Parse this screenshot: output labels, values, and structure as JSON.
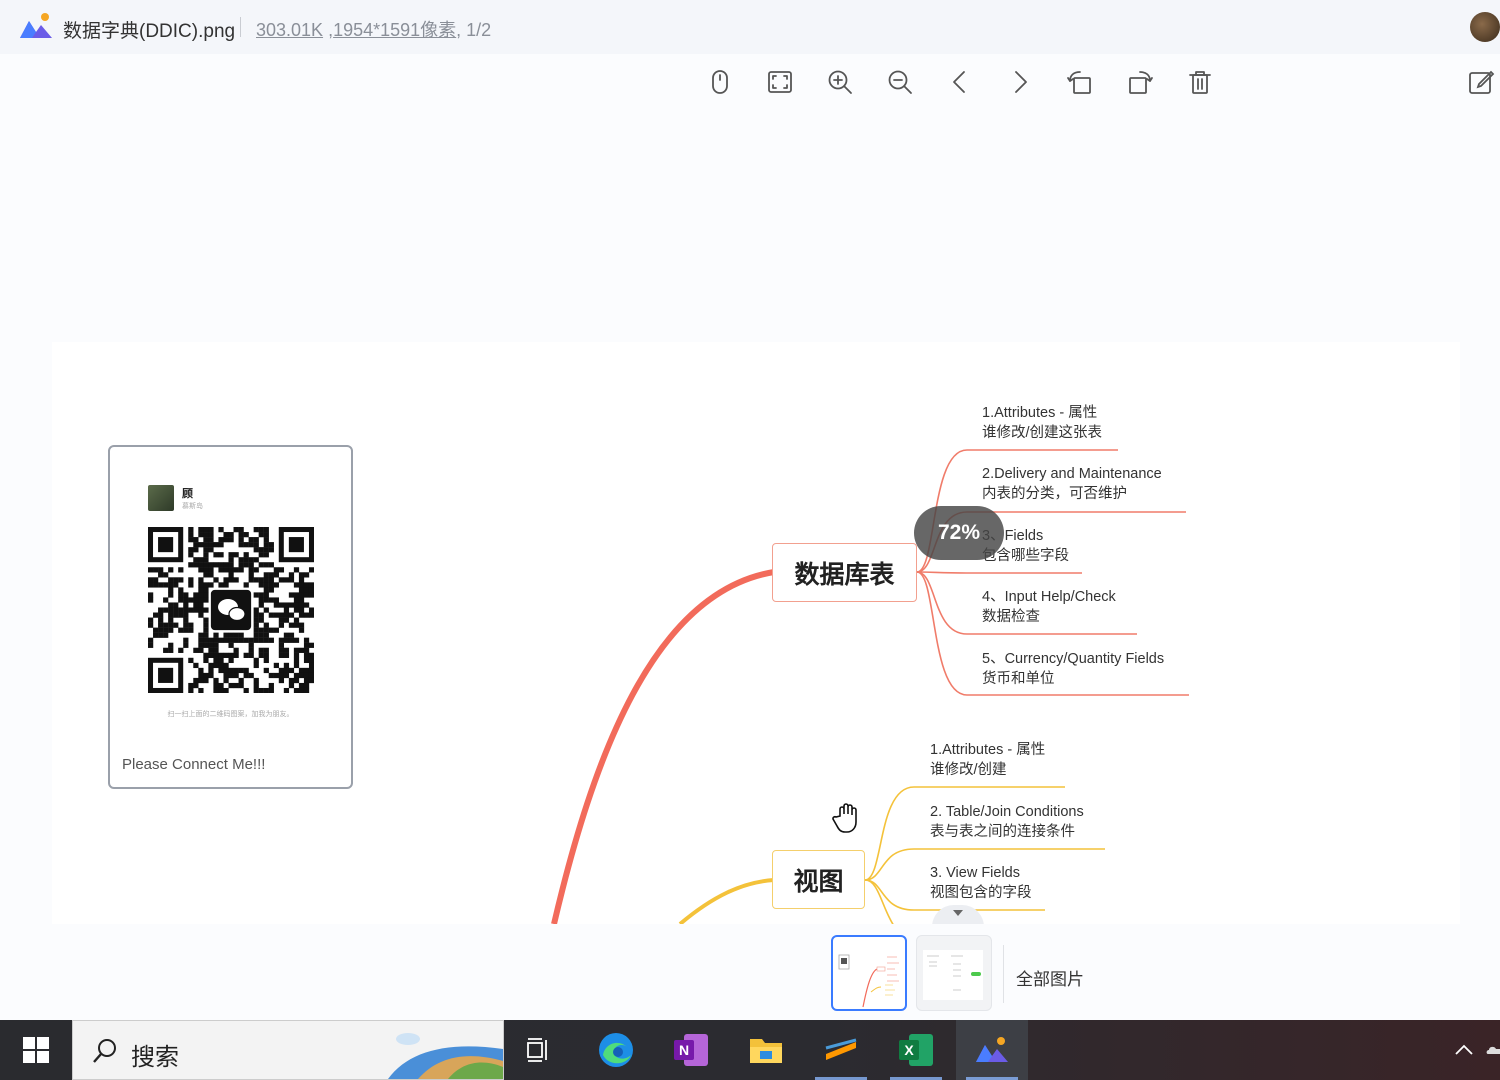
{
  "titlebar": {
    "file_name": "数据字典(DDIC).png",
    "file_size": "303.01K",
    "dimensions": "1954*1591像素",
    "page_index": ", 1/2",
    "meta_sep": " ,"
  },
  "toolbar": {
    "items": [
      "mouse-mode-icon",
      "fit-screen-icon",
      "zoom-in-icon",
      "zoom-out-icon",
      "previous-icon",
      "next-icon",
      "rotate-left-icon",
      "rotate-right-icon",
      "delete-icon"
    ],
    "edit": "edit-icon"
  },
  "qr_card": {
    "name": "顾",
    "sub": "慕斯岛",
    "hint": "扫一扫上面的二维码图案，加我为朋友。",
    "caption": "Please Connect Me!!!"
  },
  "mindmap": {
    "table_node": "数据库表",
    "table_leaves": [
      {
        "line1": "1.Attributes - 属性",
        "line2": "谁修改/创建这张表"
      },
      {
        "line1": "2.Delivery and Maintenance",
        "line2": "内表的分类，可否维护"
      },
      {
        "line1": "3、Fields",
        "line2": "包含哪些字段"
      },
      {
        "line1": "4、Input Help/Check",
        "line2": "数据检查"
      },
      {
        "line1": "5、Currency/Quantity Fields",
        "line2": "货币和单位"
      }
    ],
    "view_node": "视图",
    "view_leaves": [
      {
        "line1": "1.Attributes - 属性",
        "line2": "谁修改/创建"
      },
      {
        "line1": "2. Table/Join Conditions",
        "line2": "表与表之间的连接条件"
      },
      {
        "line1": "3. View Fields",
        "line2": "视图包含的字段"
      }
    ],
    "colors": {
      "table_branch": "#f07c6a",
      "view_branch": "#f4c23a",
      "main_branch": "#f26b5b"
    }
  },
  "zoom": "72%",
  "thumbnails": {
    "all_label": "全部图片",
    "selected": 1,
    "count": 2
  },
  "taskbar": {
    "search_placeholder": "搜索",
    "apps": [
      "task-view-icon",
      "edge-icon",
      "onenote-icon",
      "file-explorer-icon",
      "sublime-icon",
      "excel-icon",
      "image-viewer-icon"
    ]
  }
}
